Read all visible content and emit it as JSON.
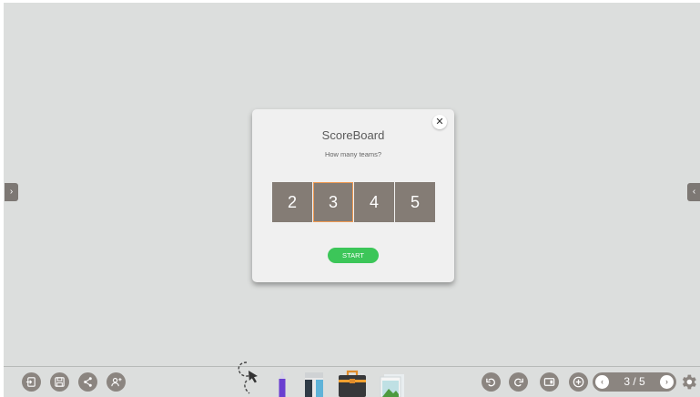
{
  "dialog": {
    "title": "ScoreBoard",
    "subtitle": "How many teams?",
    "options": [
      "2",
      "3",
      "4",
      "5"
    ],
    "selected_option": "3",
    "start_label": "START",
    "close_glyph": "✕"
  },
  "side_tabs": {
    "left_glyph": "›",
    "right_glyph": "‹"
  },
  "pager": {
    "text": "3 / 5",
    "prev_glyph": "‹",
    "next_glyph": "›"
  },
  "toolbar_left": [
    "exit-icon",
    "save-icon",
    "share-icon",
    "add-user-icon"
  ],
  "tools": [
    "lasso-select-icon",
    "pen-icon",
    "eraser-icon",
    "toolbox-icon",
    "gallery-icon"
  ],
  "toolbar_right": [
    "undo-icon",
    "redo-icon",
    "screen-capture-icon",
    "add-page-icon",
    "settings-icon"
  ],
  "colors": {
    "canvas": "#dcdedd",
    "option_bg": "#847c75",
    "selected_border": "#f09a52",
    "start_green": "#3cc659",
    "toolbar_button": "#8b8580"
  }
}
